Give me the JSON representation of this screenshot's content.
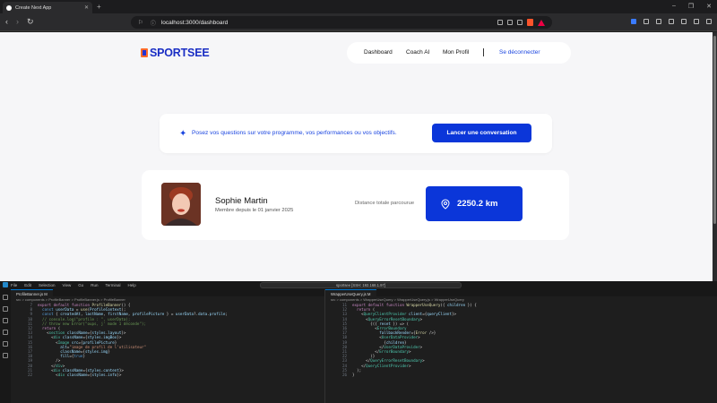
{
  "browser": {
    "tab_title": "Create Next App",
    "url": "localhost:3000/dashboard"
  },
  "app": {
    "brand": "SPORTSEE",
    "nav": {
      "dashboard": "Dashboard",
      "coach": "Coach AI",
      "profile": "Mon Profil",
      "logout": "Se déconnecter"
    },
    "ai_prompt": {
      "text": "Posez vos questions sur votre programme, vos performances ou vos objectifs.",
      "button": "Lancer une conversation"
    },
    "profile": {
      "name": "Sophie Martin",
      "member_since": "Membre depuis le 01 janvier 2025",
      "distance_label": "Distance totale parcourue",
      "distance_value": "2250.2 km"
    },
    "colors": {
      "accent": "#0b36d9",
      "brand_orange": "#ff6b2b"
    }
  },
  "vscode": {
    "menu": [
      "File",
      "Edit",
      "Selection",
      "View",
      "Go",
      "Run",
      "Terminal",
      "Help"
    ],
    "command_center": "sportsee [SSH: 192.168.1.97]",
    "left_tab": "ProfileBanner.js M",
    "left_crumb": "src > components > ProfileBanner > ProfileBanner.js > ProfileBanner",
    "right_tab": "WrapperUseQuery.js M",
    "right_crumb": "src > components > WrapperUseQuery > WrapperUseQuery.js > WrapperUseQuery"
  }
}
